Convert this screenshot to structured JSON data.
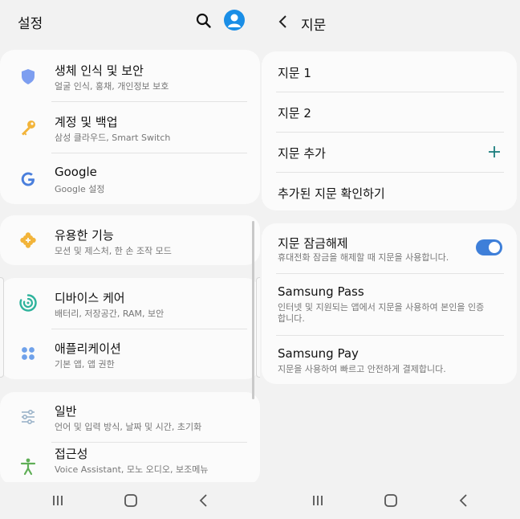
{
  "settings": {
    "title": "설정",
    "groups": [
      {
        "items": [
          {
            "title": "생체 인식 및 보안",
            "subtitle": "얼굴 인식, 홍채, 개인정보 보호",
            "icon": "shield-icon"
          },
          {
            "title": "계정 및 백업",
            "subtitle": "삼성 클라우드, Smart Switch",
            "icon": "key-icon"
          },
          {
            "title": "Google",
            "subtitle": "Google 설정",
            "icon": "google-icon"
          }
        ]
      },
      {
        "items": [
          {
            "title": "유용한 기능",
            "subtitle": "모션 및 제스처, 한 손 조작 모드",
            "icon": "puzzle-icon"
          }
        ]
      },
      {
        "items": [
          {
            "title": "디바이스 케어",
            "subtitle": "배터리, 저장공간, RAM, 보안",
            "icon": "device-care-icon"
          },
          {
            "title": "애플리케이션",
            "subtitle": "기본 앱, 앱 권한",
            "icon": "apps-icon"
          }
        ]
      },
      {
        "items": [
          {
            "title": "일반",
            "subtitle": "언어 및 입력 방식, 날짜 및 시간, 초기화",
            "icon": "sliders-icon"
          },
          {
            "title": "접근성",
            "subtitle": "Voice Assistant, 모노 오디오, 보조메뉴",
            "icon": "accessibility-icon"
          }
        ]
      }
    ]
  },
  "fingerprint": {
    "title": "지문",
    "list": [
      {
        "label": "지문 1"
      },
      {
        "label": "지문 2"
      },
      {
        "label": "지문 추가"
      },
      {
        "label": "추가된 지문 확인하기"
      }
    ],
    "options": [
      {
        "title": "지문 잠금해제",
        "subtitle": "휴대전화 잠금을 해제할 때 지문을 사용합니다.",
        "toggle": true
      },
      {
        "title": "Samsung Pass",
        "subtitle": "인터넷 및 지원되는 앱에서 지문을 사용하여 본인을 인증합니다."
      },
      {
        "title": "Samsung Pay",
        "subtitle": "지문을 사용하여 빠르고 안전하게 결제합니다."
      }
    ]
  },
  "colors": {
    "accent": "#3e7fd9",
    "avatar": "#1a8ee6",
    "teal": "#1c7d7d"
  }
}
